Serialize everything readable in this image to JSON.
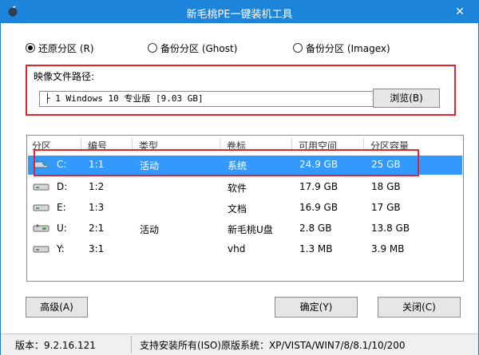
{
  "title_bar": {
    "title": "新毛桃PE一键装机工具",
    "close_glyph": "✕",
    "app_icon": "peach-logo-icon",
    "bg_color": "#1c84da"
  },
  "mode": {
    "options": [
      {
        "label": "还原分区 (R)",
        "checked": true
      },
      {
        "label": "备份分区 (Ghost)",
        "checked": false
      },
      {
        "label": "备份分区 (Imagex)",
        "checked": false
      }
    ]
  },
  "image_file": {
    "label": "映像文件路径:",
    "selected": "├ 1 Windows 10 专业版 [9.03 GB]",
    "browse_label": "浏览(B)"
  },
  "partitions": {
    "columns": [
      "分区",
      "编号",
      "类型",
      "卷标",
      "可用空间",
      "分区容量"
    ],
    "rows": [
      {
        "drive": "C:",
        "number": "1:1",
        "type": "活动",
        "label": "系统",
        "free": "24.9 GB",
        "capacity": "25 GB",
        "selected": true,
        "icon": "system-drive-icon"
      },
      {
        "drive": "D:",
        "number": "1:2",
        "type": "",
        "label": "软件",
        "free": "17.9 GB",
        "capacity": "18 GB",
        "selected": false,
        "icon": "hard-drive-icon"
      },
      {
        "drive": "E:",
        "number": "1:3",
        "type": "",
        "label": "文档",
        "free": "16.9 GB",
        "capacity": "17 GB",
        "selected": false,
        "icon": "hard-drive-icon"
      },
      {
        "drive": "U:",
        "number": "2:1",
        "type": "活动",
        "label": "新毛桃U盘",
        "free": "2.8 GB",
        "capacity": "13.8 GB",
        "selected": false,
        "icon": "usb-drive-icon"
      },
      {
        "drive": "Y:",
        "number": "3:1",
        "type": "",
        "label": "vhd",
        "free": "1.3 MB",
        "capacity": "3.9 MB",
        "selected": false,
        "icon": "hard-drive-icon"
      }
    ]
  },
  "buttons": {
    "advanced": "高级(A)",
    "ok": "确定(Y)",
    "close": "关闭(C)"
  },
  "status_bar": {
    "version": "版本：9.2.16.121",
    "support": "支持安装所有(ISO)原版系统：XP/VISTA/WIN7/8/8.1/10/200"
  },
  "colors": {
    "highlight": "#e0252b",
    "selection": "#3399ff"
  }
}
